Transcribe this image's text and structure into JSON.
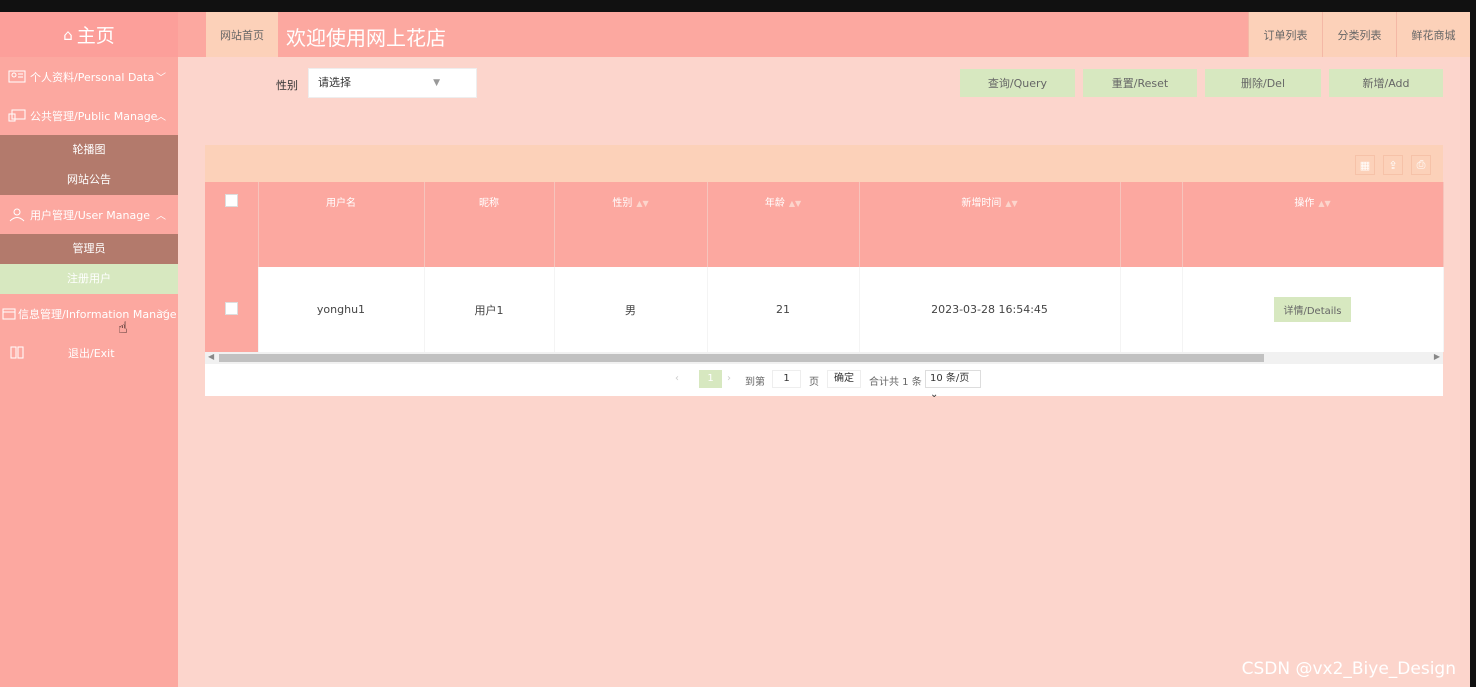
{
  "sidebar": {
    "logo": "主页",
    "items": [
      {
        "label": "个人资料/Personal Data"
      },
      {
        "label": "公共管理/Public Manage",
        "sub": [
          "轮播图",
          "网站公告"
        ]
      },
      {
        "label": "用户管理/User Manage",
        "sub": [
          "管理员",
          "注册用户"
        ]
      },
      {
        "label": "信息管理/Information Manage"
      },
      {
        "label": "退出/Exit"
      }
    ]
  },
  "topbar": {
    "home_tab": "网站首页",
    "title": "欢迎使用网上花店",
    "nav": [
      "订单列表",
      "分类列表",
      "鲜花商城"
    ]
  },
  "filter": {
    "label": "性别",
    "placeholder": "请选择"
  },
  "buttons": {
    "query": "查询/Query",
    "reset": "重置/Reset",
    "delete": "删除/Del",
    "add": "新增/Add"
  },
  "table": {
    "headers": [
      "用户名",
      "昵称",
      "性别",
      "年龄",
      "新增时间",
      "",
      "操作"
    ],
    "rows": [
      {
        "username": "yonghu1",
        "nickname": "用户1",
        "gender": "男",
        "age": "21",
        "created": "2023-03-28 16:54:45",
        "action": "详情/Details"
      }
    ]
  },
  "pager": {
    "current": "1",
    "goto_prefix": "到第",
    "goto_value": "1",
    "page_suffix": "页",
    "confirm": "确定",
    "total": "合计共 1 条",
    "page_size": "10 条/页"
  },
  "watermark": "CSDN @vx2_Biye_Design",
  "colors": {
    "primary": "#fca8a0",
    "background": "#fcd5cc",
    "accent_green": "#d7e8c0",
    "sub_menu": "#b37a6c"
  }
}
